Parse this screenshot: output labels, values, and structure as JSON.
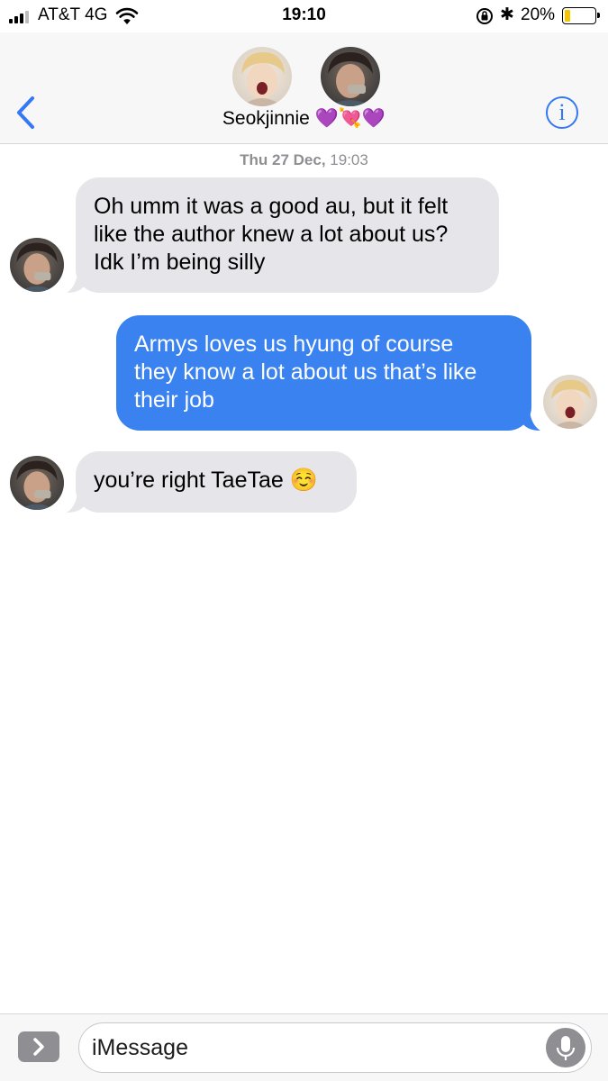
{
  "status_bar": {
    "carrier": "AT&T 4G",
    "time": "19:10",
    "battery_percent": "20%",
    "battery_level": 0.2
  },
  "header": {
    "contact_name": "Seokjinnie 💜💘💜",
    "info_label": "i"
  },
  "thread": {
    "timestamp_day": "Thu 27 Dec,",
    "timestamp_time": "19:03",
    "messages": [
      {
        "direction": "incoming",
        "lines": [
          "Oh umm it was a good au, but it felt",
          "like the author knew a lot about us?",
          "Idk I’m being silly"
        ]
      },
      {
        "direction": "outgoing",
        "lines": [
          "Armys loves us hyung of course",
          "they know a lot about us that’s like",
          "their job"
        ]
      },
      {
        "direction": "incoming",
        "lines": [
          "you’re right TaeTae ☺️"
        ]
      }
    ]
  },
  "input_bar": {
    "placeholder": "iMessage"
  },
  "colors": {
    "accent": "#3478f6",
    "outgoing_bubble": "#3a82f0",
    "incoming_bubble": "#e5e5ea",
    "battery_fill": "#f5c400"
  },
  "icons": [
    "signal-bars-icon",
    "wifi-icon",
    "rotation-lock-icon",
    "bluetooth-icon",
    "battery-icon",
    "back-chevron-icon",
    "info-icon",
    "app-drawer-chevron-icon",
    "microphone-icon"
  ]
}
